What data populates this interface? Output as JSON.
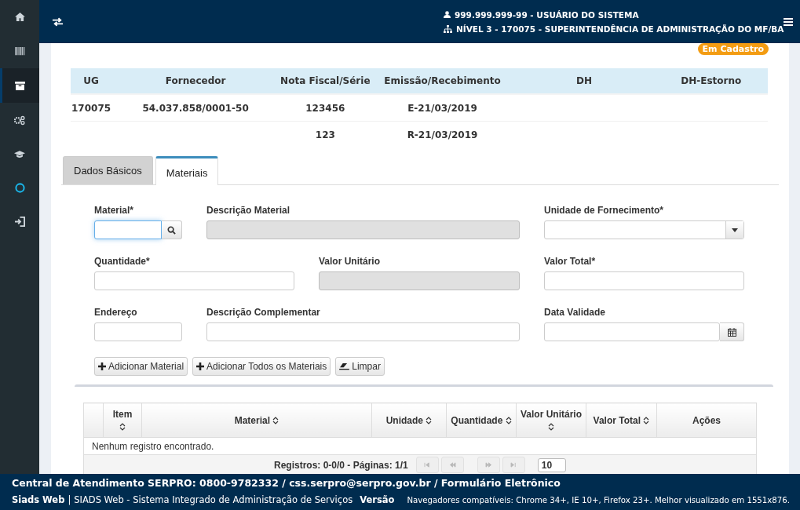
{
  "sidebar": {
    "items": [
      {
        "selected": false
      },
      {
        "selected": false
      },
      {
        "selected": true
      },
      {
        "selected": false
      },
      {
        "selected": false
      },
      {
        "selected": false
      },
      {
        "selected": false
      }
    ]
  },
  "header": {
    "user": "999.999.999-99 - USUÁRIO DO SISTEMA",
    "unit": "NÍVEL 3 - 170075 - SUPERINTENDÊNCIA DE ADMINISTRAÇÃO DO MF/BA"
  },
  "status_badge": "Em Cadastro",
  "summary": {
    "columns": [
      "UG",
      "Fornecedor",
      "Nota Fiscal/Série",
      "Emissão/Recebimento",
      "DH",
      "DH-Estorno"
    ],
    "rows": [
      [
        "170075",
        "54.037.858/0001-50",
        "123456",
        "E-21/03/2019",
        "",
        ""
      ],
      [
        "",
        "",
        "123",
        "R-21/03/2019",
        "",
        ""
      ]
    ]
  },
  "tabs": [
    {
      "label": "Dados Básicos",
      "selected": false
    },
    {
      "label": "Materiais",
      "selected": true
    }
  ],
  "form": {
    "fields": [
      {
        "label": "Material*",
        "kind": "search",
        "disabled": false,
        "focused": true
      },
      {
        "label": "Descrição Material",
        "kind": "text",
        "disabled": true,
        "focused": false
      },
      {
        "label": "Unidade de Fornecimento*",
        "kind": "select",
        "disabled": false,
        "focused": false
      },
      {
        "label": "Quantidade*",
        "kind": "text",
        "disabled": false,
        "focused": false
      },
      {
        "label": "Valor Unitário",
        "kind": "text",
        "disabled": true,
        "focused": false
      },
      {
        "label": "Valor Total*",
        "kind": "text",
        "disabled": false,
        "focused": false
      },
      {
        "label": "Endereço",
        "kind": "text",
        "disabled": false,
        "focused": false
      },
      {
        "label": "Descrição Complementar",
        "kind": "text",
        "disabled": false,
        "focused": false
      },
      {
        "label": "Data Validade",
        "kind": "date",
        "disabled": false,
        "focused": false
      }
    ],
    "buttons": [
      {
        "label": "Adicionar Material",
        "kind": "add"
      },
      {
        "label": "Adicionar Todos os Materiais",
        "kind": "add"
      },
      {
        "label": "Limpar",
        "kind": "clear"
      }
    ]
  },
  "materials_table": {
    "columns": [
      {
        "sortable": false
      },
      {
        "label": "Item",
        "sortable": true
      },
      {
        "label": "Material",
        "sortable": true
      },
      {
        "label": "Unidade",
        "sortable": true
      },
      {
        "label": "Quantidade",
        "sortable": true
      },
      {
        "label": "Valor Unitário",
        "sortable": true
      },
      {
        "label": "Valor Total",
        "sortable": true
      },
      {
        "label": "Ações",
        "sortable": false
      }
    ],
    "empty_message": "Nenhum registro encontrado.",
    "paginator": {
      "summary": "Registros: 0-0/0 - Páginas: 1/1",
      "buttons": [
        {
          "disabled": true
        },
        {
          "disabled": true
        },
        {
          "disabled": true
        },
        {
          "disabled": true
        }
      ],
      "rows_per_page": "10"
    }
  },
  "footer": {
    "contact": "Central de Atendimento SERPRO: 0800-9782332 / css.serpro@serpro.gov.br / Formulário Eletrônico",
    "app_name": "Siads Web",
    "separator": "|",
    "app_title": "SIADS Web - Sistema Integrado de Administração de Serviços",
    "version_label": "Versão",
    "browsers": "Navegadores compatíveis: Chrome 34+, IE 10+, Firefox 23+. Melhor visualizado em 1551x876."
  }
}
